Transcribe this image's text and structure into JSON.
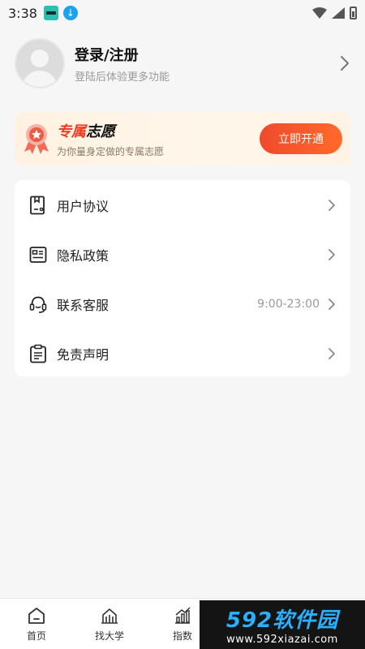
{
  "status_bar": {
    "time": "3:38"
  },
  "profile": {
    "title": "登录/注册",
    "subtitle": "登陆后体验更多功能"
  },
  "vip": {
    "title_part1": "专属",
    "title_part2": "志愿",
    "subtitle": "为你量身定做的专属志愿",
    "button": "立即开通"
  },
  "menu": {
    "items": [
      {
        "label": "用户协议",
        "icon": "document-icon"
      },
      {
        "label": "隐私政策",
        "icon": "id-card-icon"
      },
      {
        "label": "联系客服",
        "icon": "headset-icon",
        "extra": "9:00-23:00"
      },
      {
        "label": "免责声明",
        "icon": "clipboard-icon"
      }
    ]
  },
  "tabs": [
    {
      "label": "首页",
      "icon": "home-icon"
    },
    {
      "label": "找大学",
      "icon": "university-icon"
    },
    {
      "label": "指数",
      "icon": "chart-icon"
    }
  ],
  "watermark": {
    "title": "592软件园",
    "url": "www.592xiazai.com"
  },
  "colors": {
    "accent_red": "#ee3b22",
    "button_gradient_start": "#f04a2c",
    "button_gradient_end": "#ff6a2a",
    "vip_bg": "#fff2e2"
  }
}
